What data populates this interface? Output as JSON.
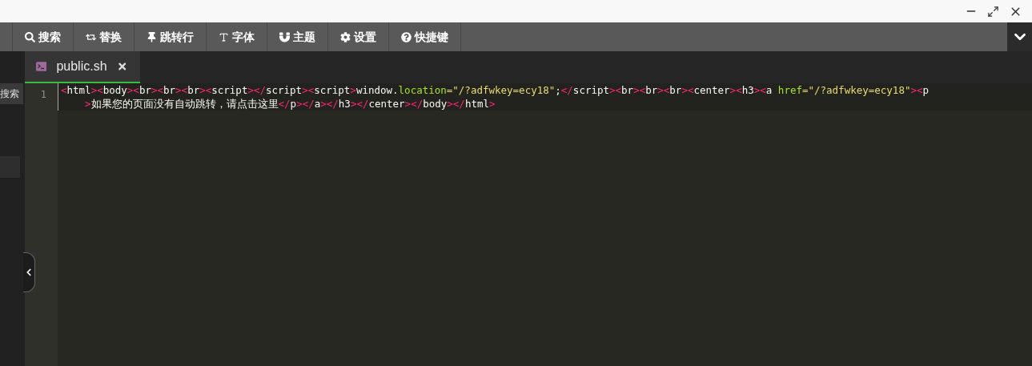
{
  "toolbar": [
    {
      "kind": "search",
      "label": "搜索"
    },
    {
      "kind": "replace",
      "label": "替换"
    },
    {
      "kind": "goto",
      "label": "跳转行"
    },
    {
      "kind": "font",
      "label": "字体"
    },
    {
      "kind": "theme",
      "label": "主题"
    },
    {
      "kind": "settings",
      "label": "设置"
    },
    {
      "kind": "shortcuts",
      "label": "快捷键"
    }
  ],
  "sidebar": {
    "button": "搜索"
  },
  "tabs": [
    {
      "label": "public.sh",
      "selected": true
    }
  ],
  "editor": {
    "lines": [
      {
        "number": "1",
        "current": true,
        "rows": [
          "<html><body><br><br><br><script></script><script>window.location=\"/?adfwkey=ecy18\";</script><br><br><br><center><h3><a href=\"/?adfwkey=ecy18\"><p",
          ">如果您的页面没有自动跳转，请点击这里</p></a></h3></center></body></html>"
        ]
      }
    ]
  }
}
